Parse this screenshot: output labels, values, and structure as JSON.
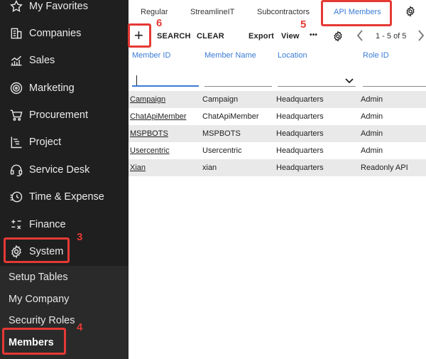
{
  "sidebar": {
    "items": [
      {
        "label": "My Favorites",
        "icon": "star-icon"
      },
      {
        "label": "Companies",
        "icon": "building-icon"
      },
      {
        "label": "Sales",
        "icon": "chart-icon"
      },
      {
        "label": "Marketing",
        "icon": "target-icon"
      },
      {
        "label": "Procurement",
        "icon": "cart-icon"
      },
      {
        "label": "Project",
        "icon": "gantt-icon"
      },
      {
        "label": "Service Desk",
        "icon": "headset-icon"
      },
      {
        "label": "Time & Expense",
        "icon": "clock-icon"
      },
      {
        "label": "Finance",
        "icon": "calculator-icon"
      },
      {
        "label": "System",
        "icon": "gear-icon"
      }
    ],
    "sub_items": [
      {
        "label": "Setup Tables"
      },
      {
        "label": "My Company"
      },
      {
        "label": "Security Roles"
      },
      {
        "label": "Members"
      }
    ]
  },
  "tabs": [
    {
      "label": "Regular"
    },
    {
      "label": "StreamlineIT"
    },
    {
      "label": "Subcontractors"
    },
    {
      "label": "API Members"
    }
  ],
  "toolbar": {
    "add": "+",
    "search": "SEARCH",
    "clear": "CLEAR",
    "export": "Export",
    "view": "View",
    "more": "•••",
    "pager": "1 - 5 of 5"
  },
  "table": {
    "columns": [
      "Member ID",
      "Member Name",
      "Location",
      "Role ID"
    ],
    "rows": [
      [
        "Campaign",
        "Campaign",
        "Headquarters",
        "Admin"
      ],
      [
        "ChatApiMember",
        "ChatApiMember",
        "Headquarters",
        "Admin"
      ],
      [
        "MSPBOTS",
        "MSPBOTS",
        "Headquarters",
        "Admin"
      ],
      [
        "Usercentric",
        "Usercentric",
        "Headquarters",
        "Admin"
      ],
      [
        "Xian",
        "xian",
        "Headquarters",
        "Readonly API"
      ]
    ]
  },
  "annotations": [
    "3",
    "4",
    "5",
    "6"
  ],
  "colors": {
    "sidebar_bg": "#1f1f1f",
    "accent": "#3a7bd5",
    "annotation": "#e53935",
    "alt_row": "#e9e9e9"
  }
}
